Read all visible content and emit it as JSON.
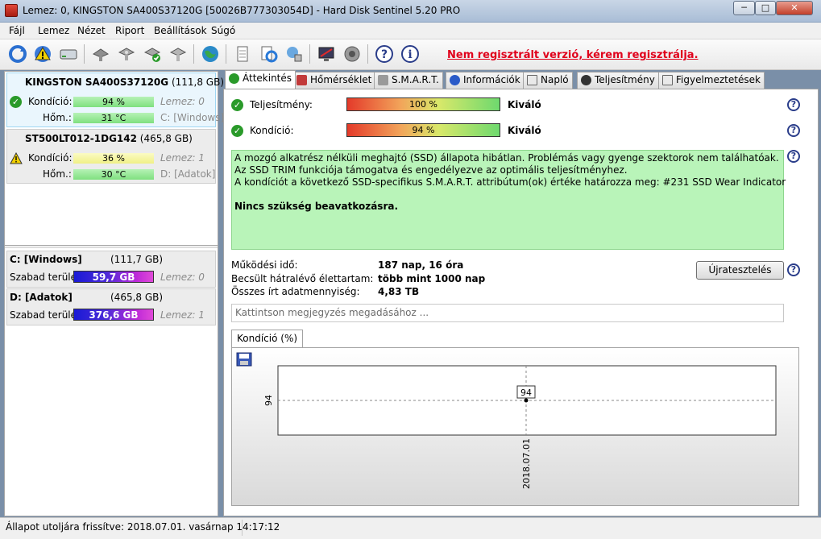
{
  "window": {
    "title": "Lemez: 0, KINGSTON SA400S37120G [50026B777303054D]  -  Hard Disk Sentinel 5.20 PRO",
    "btn_min": "─",
    "btn_max": "□",
    "btn_close": "✕"
  },
  "menu": [
    "Fájl",
    "Lemez",
    "Nézet",
    "Riport",
    "Beállítások",
    "Súgó"
  ],
  "toolbar": {
    "register_link": "Nem regisztrált verzió, kérem regisztrálja."
  },
  "disks": [
    {
      "model": "KINGSTON SA400S37120G",
      "size": "(111,8 GB)",
      "condition_label": "Kondíció:",
      "condition": "94 %",
      "condition_pct": 94,
      "temp_label": "Hőm.:",
      "temp": "31 °C",
      "disk_index": "Lemez: 0",
      "volume": "C: [Windows]"
    },
    {
      "model": "ST500LT012-1DG142",
      "size": "(465,8 GB)",
      "condition_label": "Kondíció:",
      "condition": "36 %",
      "condition_pct": 36,
      "temp_label": "Hőm.:",
      "temp": "30 °C",
      "disk_index": "Lemez: 1",
      "volume": "D: [Adatok]"
    }
  ],
  "volumes": [
    {
      "name": "C: [Windows]",
      "size": "(111,7 GB)",
      "free_label": "Szabad terület",
      "free": "59,7 GB",
      "free_pct": 53,
      "disk": "Lemez: 0"
    },
    {
      "name": "D: [Adatok]",
      "size": "(465,8 GB)",
      "free_label": "Szabad terület",
      "free": "376,6 GB",
      "free_pct": 81,
      "disk": "Lemez: 1"
    }
  ],
  "tabs": [
    "Áttekintés",
    "Hőmérséklet",
    "S.M.A.R.T.",
    "Információk",
    "Napló",
    "Teljesítmény",
    "Figyelmeztetések"
  ],
  "overview": {
    "performance_label": "Teljesítmény:",
    "performance_value": "100 %",
    "performance_pct": 100,
    "performance_rating": "Kiváló",
    "health_label": "Kondíció:",
    "health_value": "94 %",
    "health_pct": 94,
    "health_rating": "Kiváló",
    "info_line1": "A mozgó alkatrész nélküli meghajtó (SSD) állapota hibátlan. Problémás vagy gyenge szektorok nem találhatóak.",
    "info_line2": "Az SSD TRIM funkciója támogatva és engedélyezve az optimális teljesítményhez.",
    "info_line3": "A kondíciót a következő SSD-specifikus S.M.A.R.T. attribútum(ok) értéke határozza meg:  #231 SSD Wear Indicator",
    "info_bold": "Nincs szükség beavatkozásra.",
    "uptime_label": "Működési idő:",
    "uptime": "187 nap, 16 óra",
    "lifetime_label": "Becsült hátralévő élettartam:",
    "lifetime": "több mint 1000 nap",
    "written_label": "Összes írt adatmennyiség:",
    "written": "4,83 TB",
    "retest_button": "Újratesztelés",
    "note_placeholder": "Kattintson megjegyzés megadásához ..."
  },
  "chart_tab": "Kondíció  (%)",
  "chart_data": {
    "type": "line",
    "x": [
      "2018.07.01"
    ],
    "series": [
      {
        "values": [
          94
        ]
      }
    ],
    "ytick": "94",
    "point_label": "94"
  },
  "status": {
    "text": "Állapot utoljára frissítve: 2018.07.01. vasárnap 14:17:12"
  }
}
